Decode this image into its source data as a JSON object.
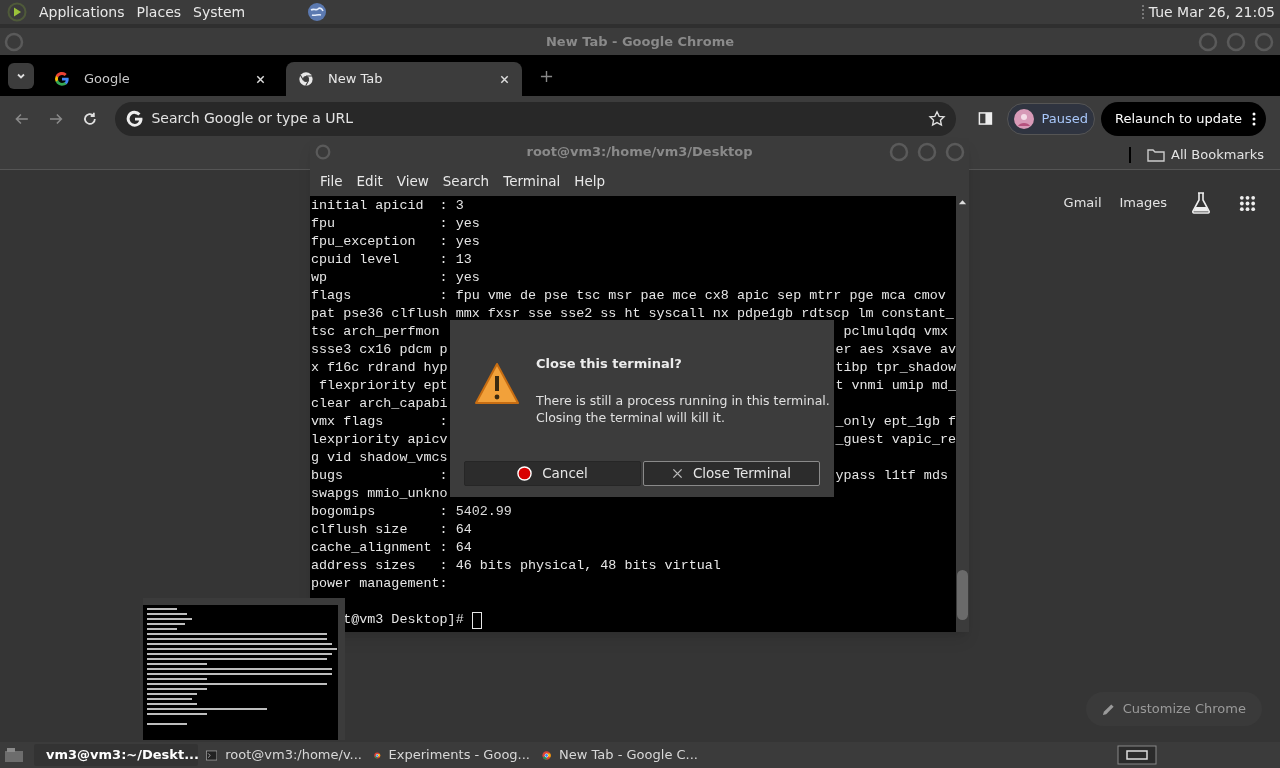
{
  "top_panel": {
    "menus": [
      "Applications",
      "Places",
      "System"
    ],
    "clock": "Tue Mar 26, 21:05"
  },
  "chrome": {
    "title": "New Tab - Google Chrome",
    "tabs": [
      {
        "label": "Google",
        "kind": "google",
        "selected": false
      },
      {
        "label": "New Tab",
        "kind": "chrome",
        "selected": true
      }
    ],
    "omnibox": {
      "placeholder": "Search Google or type a URL"
    },
    "profile": "Paused",
    "update_button": "Relaunch to update",
    "bookmarks": "All Bookmarks",
    "links": [
      "Gmail",
      "Images"
    ],
    "customize": "Customize Chrome"
  },
  "terminal": {
    "title": "root@vm3:/home/vm3/Desktop",
    "menu": [
      "File",
      "Edit",
      "View",
      "Search",
      "Terminal",
      "Help"
    ],
    "lines": [
      {
        "left": "initial apicid  : 3"
      },
      {
        "left": "fpu             : yes"
      },
      {
        "left": "fpu_exception   : yes"
      },
      {
        "left": "cpuid level     : 13"
      },
      {
        "left": "wp              : yes"
      },
      {
        "left": "flags           : fpu vme de pse tsc msr pae mce cx8 apic sep mtrr pge mca cmov"
      },
      {
        "left": "pat pse36 clflush mmx fxsr sse sse2 ss ht syscall nx pdpe1gb rdtscp lm constant_"
      },
      {
        "left": "tsc arch_perfmon",
        "right": "pclmulqdq vmx "
      },
      {
        "left": "ssse3 cx16 pdcm p",
        "right": "er aes xsave av"
      },
      {
        "left": "x f16c rdrand hyp",
        "right": "tibp tpr_shadow"
      },
      {
        "left": " flexpriority ept",
        "right": "t vnmi umip md_"
      },
      {
        "left": "clear arch_capabi"
      },
      {
        "left": "vmx flags       :",
        "right": "_only ept_1gb f"
      },
      {
        "left": "lexpriority apicv",
        "right": "_guest vapic_re"
      },
      {
        "left": "g vid shadow_vmcs"
      },
      {
        "left": "bugs            :",
        "right": "ypass l1tf mds "
      },
      {
        "left": "swapgs mmio_unkno"
      },
      {
        "left": "bogomips        : 5402.99"
      },
      {
        "left": "clflush size    : 64"
      },
      {
        "left": "cache_alignment : 64"
      },
      {
        "left": "address sizes   : 46 bits physical, 48 bits virtual"
      },
      {
        "left": "power management:"
      }
    ],
    "prompt": "t@vm3 Desktop]# "
  },
  "dialog": {
    "title": "Close this terminal?",
    "message": [
      "There is still a process running in this terminal.",
      "Closing the terminal will kill it."
    ],
    "buttons": [
      {
        "label": "Cancel",
        "kind": "cancel",
        "focused": false
      },
      {
        "label": "Close Terminal",
        "kind": "close",
        "focused": true
      }
    ]
  },
  "taskbar": [
    {
      "label": "vm3@vm3:~/Deskt...",
      "kind": "terminal",
      "selected": true
    },
    {
      "label": "root@vm3:/home/v...",
      "kind": "terminal",
      "selected": false
    },
    {
      "label": "Experiments - Goog...",
      "kind": "chrome",
      "selected": false
    },
    {
      "label": "New Tab - Google C...",
      "kind": "chrome",
      "selected": false
    }
  ]
}
